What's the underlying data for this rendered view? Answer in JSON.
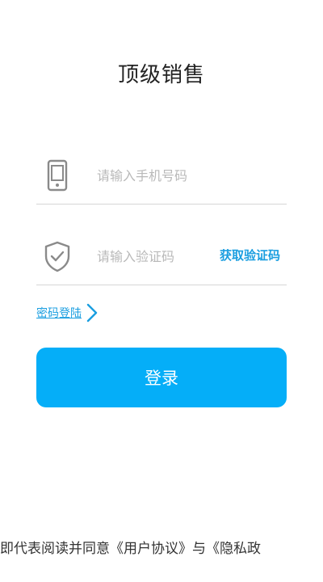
{
  "header": {
    "title": "顶级销售"
  },
  "phone_field": {
    "icon": "phone-icon",
    "placeholder": "请输入手机号码",
    "value": ""
  },
  "code_field": {
    "icon": "shield-check-icon",
    "placeholder": "请输入验证码",
    "value": "",
    "get_code_label": "获取验证码"
  },
  "password_login": {
    "label": "密码登陆",
    "icon": "chevron-right-icon"
  },
  "login_button": {
    "label": "登录"
  },
  "agreement": {
    "text": "即代表阅读并同意《用户协议》与《隐私政"
  },
  "colors": {
    "accent": "#05aef8",
    "link": "#1a9ee0",
    "icon_gray": "#8a8a8a"
  }
}
